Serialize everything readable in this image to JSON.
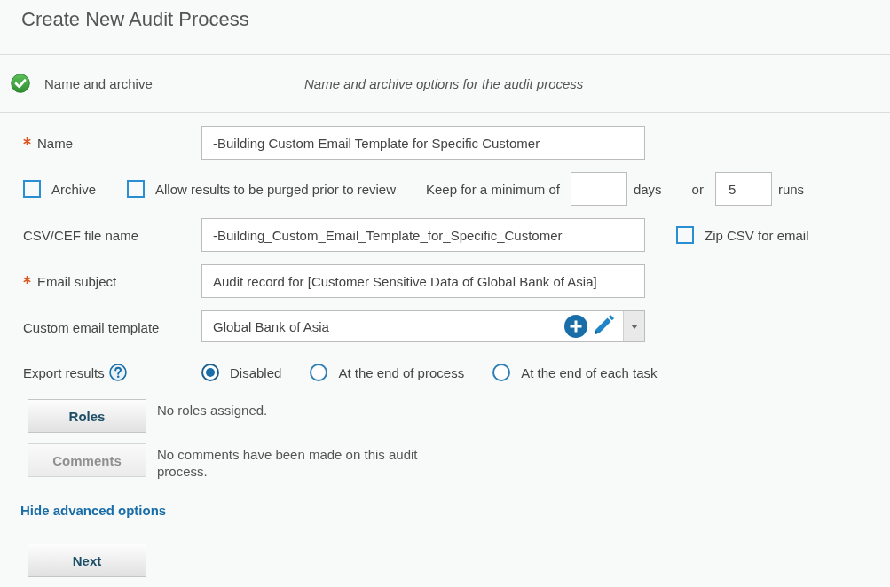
{
  "title": "Create New Audit Process",
  "step": {
    "label": "Name and archive",
    "description": "Name and archive options for the audit process",
    "completed": true
  },
  "rows": [
    {
      "kind": "text",
      "label": "Name",
      "required": true,
      "value": "-Building Custom Email Template for Specific Customer"
    },
    {
      "kind": "retention",
      "checkboxes": [
        {
          "label": "Archive",
          "checked": false
        },
        {
          "label": "Allow results to be purged prior to review",
          "checked": false
        }
      ],
      "keep_label": "Keep for a minimum of",
      "days_unit": "days",
      "or_label": "or",
      "runs_value": "5",
      "runs_unit": "runs"
    },
    {
      "kind": "text",
      "label": "CSV/CEF file name",
      "required": false,
      "value": "-Building_Custom_Email_Template_for_Specific_Customer",
      "option": {
        "label": "Zip CSV for email",
        "checked": false
      }
    },
    {
      "kind": "text",
      "label": "Email subject",
      "required": true,
      "value": "Audit record for [Customer Sensitive Data of Global Bank of Asia]"
    },
    {
      "kind": "select",
      "label": "Custom email template",
      "required": false,
      "value": "Global Bank of Asia"
    },
    {
      "kind": "radios",
      "label": "Export results",
      "options": [
        {
          "label": "Disabled",
          "selected": true
        },
        {
          "label": "At the end of process",
          "selected": false
        },
        {
          "label": "At the end of each task",
          "selected": false
        }
      ]
    }
  ],
  "actions": [
    {
      "label": "Roles",
      "disabled": false,
      "note": "No roles assigned."
    },
    {
      "label": "Comments",
      "disabled": true,
      "note": "No comments have been made on this audit process."
    }
  ],
  "advanced_link": "Hide advanced options",
  "next_button": "Next"
}
